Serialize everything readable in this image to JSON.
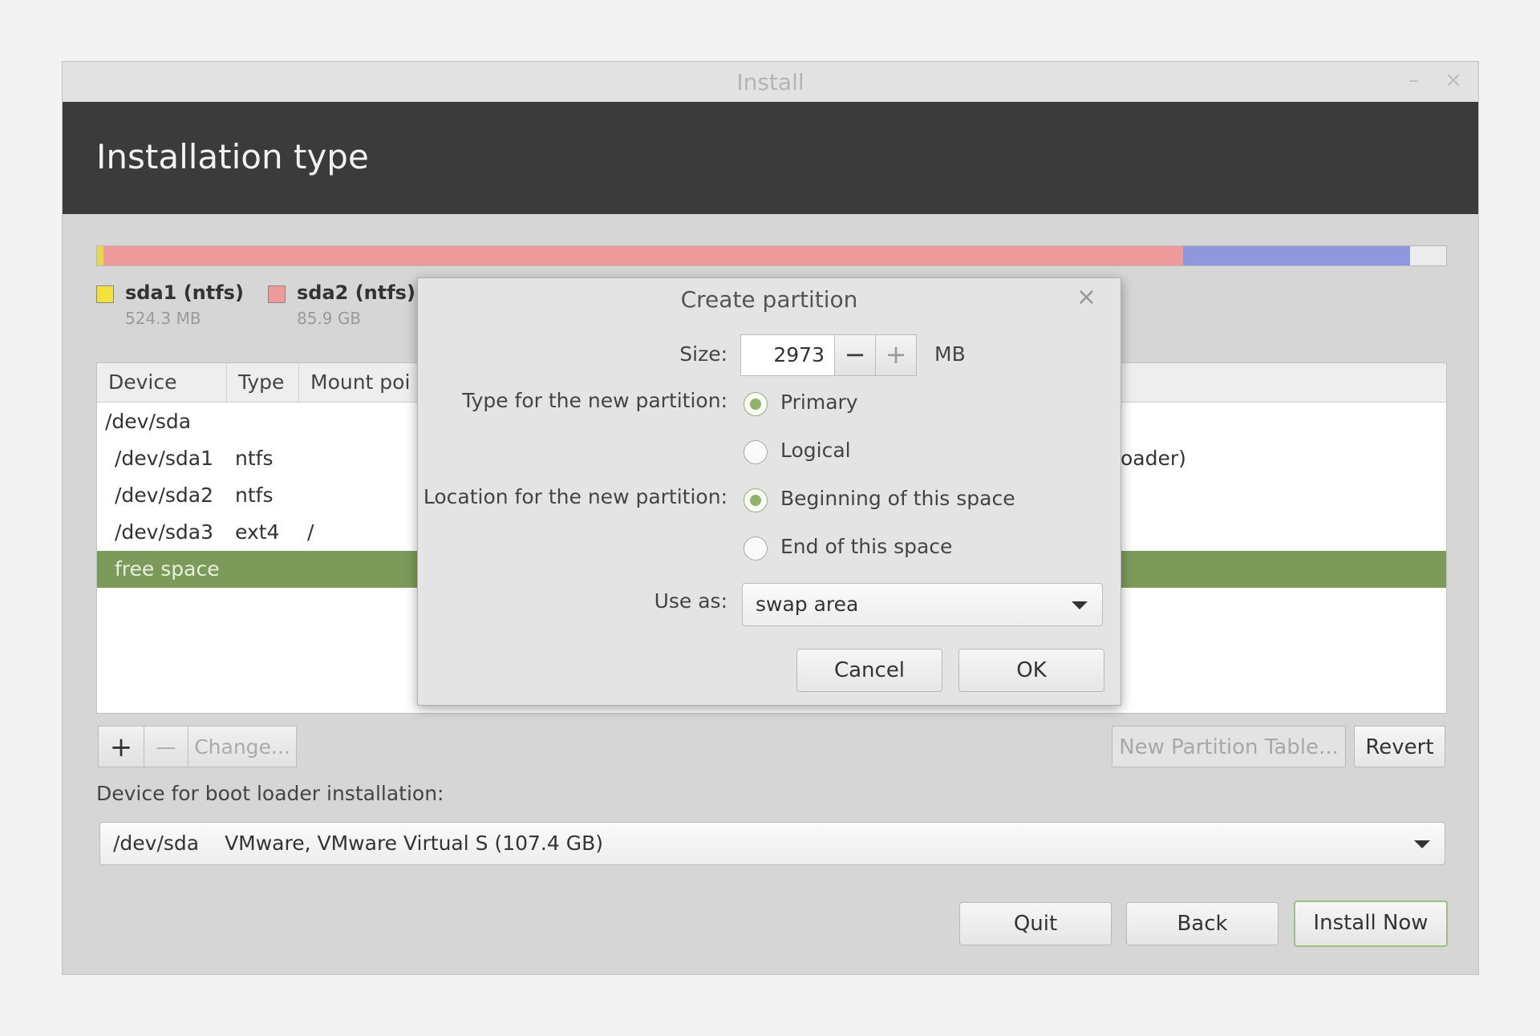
{
  "window": {
    "title": "Install",
    "minimize_glyph": "–",
    "close_glyph": "×"
  },
  "header": {
    "title": "Installation type"
  },
  "partition_bar": {
    "segments": [
      {
        "name": "sda1",
        "color": "#e6d84a",
        "fraction": 0.005
      },
      {
        "name": "sda2",
        "color": "#ee9a9a",
        "fraction": 0.8
      },
      {
        "name": "sda3",
        "color": "#8f97df",
        "fraction": 0.168
      },
      {
        "name": "free space",
        "color": "#ececec",
        "fraction": 0.027
      }
    ]
  },
  "legend": [
    {
      "name": "sda1 (ntfs)",
      "size": "524.3 MB",
      "color": "#f1e33b"
    },
    {
      "name": "sda2 (ntfs)",
      "size": "85.9 GB",
      "color": "#ee9a9a"
    }
  ],
  "table": {
    "headers": [
      "Device",
      "Type",
      "Mount poi"
    ],
    "rows": [
      {
        "device": "/dev/sda",
        "type": "",
        "mount": "",
        "extra": ""
      },
      {
        "device": "/dev/sda1",
        "type": "ntfs",
        "mount": "",
        "extra": "oader)"
      },
      {
        "device": "/dev/sda2",
        "type": "ntfs",
        "mount": "",
        "extra": ""
      },
      {
        "device": "/dev/sda3",
        "type": "ext4",
        "mount": "/",
        "extra": ""
      },
      {
        "device": "free space",
        "type": "",
        "mount": "",
        "extra": ""
      }
    ],
    "selected_color": "#7c9b5a"
  },
  "toolbar": {
    "add_label": "+",
    "remove_label": "—",
    "change_label": "Change...",
    "new_table_label": "New Partition Table...",
    "revert_label": "Revert"
  },
  "bootloader": {
    "label": "Device for boot loader installation:",
    "device": "/dev/sda",
    "description": "VMware, VMware Virtual S (107.4 GB)"
  },
  "footer": {
    "quit_label": "Quit",
    "back_label": "Back",
    "install_label": "Install Now"
  },
  "dialog": {
    "title": "Create partition",
    "close_glyph": "×",
    "size_label": "Size:",
    "size_value": "2973",
    "size_minus": "−",
    "size_plus": "+",
    "size_unit": "MB",
    "type_label": "Type for the new partition:",
    "type_primary": "Primary",
    "type_logical": "Logical",
    "location_label": "Location for the new partition:",
    "location_beginning": "Beginning of this space",
    "location_end": "End of this space",
    "useas_label": "Use as:",
    "useas_value": "swap area",
    "cancel_label": "Cancel",
    "ok_label": "OK"
  }
}
